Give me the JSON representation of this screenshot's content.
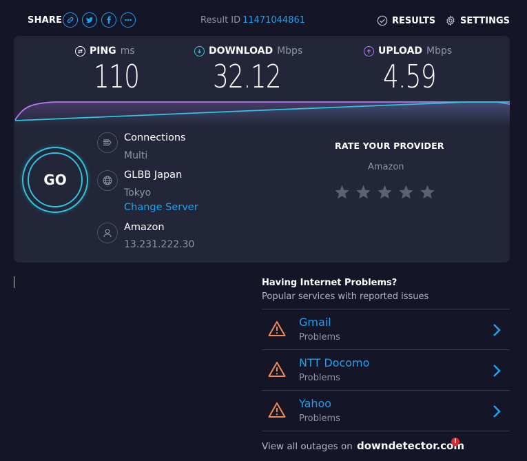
{
  "topbar": {
    "share_label": "SHARE",
    "share_buttons": [
      {
        "icon": "link-icon"
      },
      {
        "icon": "twitter-icon"
      },
      {
        "icon": "facebook-icon"
      },
      {
        "icon": "more-icon"
      }
    ],
    "result_label": "Result ID",
    "result_id": "11471044861",
    "results_label": "RESULTS",
    "settings_label": "SETTINGS"
  },
  "metrics": {
    "ping": {
      "label": "PING",
      "unit": "ms",
      "value": "110",
      "color": "#ffffff"
    },
    "download": {
      "label": "DOWNLOAD",
      "unit": "Mbps",
      "value": "32.12",
      "color": "#2cc6e0"
    },
    "upload": {
      "label": "UPLOAD",
      "unit": "Mbps",
      "value": "4.59",
      "color": "#b279f0"
    }
  },
  "go_label": "GO",
  "server": {
    "connections_title": "Connections",
    "connections_value": "Multi",
    "server_name": "GLBB Japan",
    "server_location": "Tokyo",
    "change_server": "Change Server",
    "isp_name": "Amazon",
    "isp_ip": "13.231.222.30"
  },
  "rate": {
    "title": "RATE YOUR PROVIDER",
    "provider": "Amazon",
    "stars": 0,
    "max_stars": 5
  },
  "problems": {
    "title": "Having Internet Problems?",
    "subtitle": "Popular services with reported issues",
    "items": [
      {
        "name": "Gmail",
        "status": "Problems"
      },
      {
        "name": "NTT Docomo",
        "status": "Problems"
      },
      {
        "name": "Yahoo",
        "status": "Problems"
      }
    ],
    "footer_text": "View all outages on",
    "footer_brand": "downdetector.com",
    "footer_badge": "!"
  },
  "colors": {
    "background": "#141526",
    "panel": "#232638",
    "accent_blue": "#1ea0f0",
    "download_cyan": "#2cc6e0",
    "upload_purple": "#b279f0",
    "warning_orange": "#f28a52"
  }
}
